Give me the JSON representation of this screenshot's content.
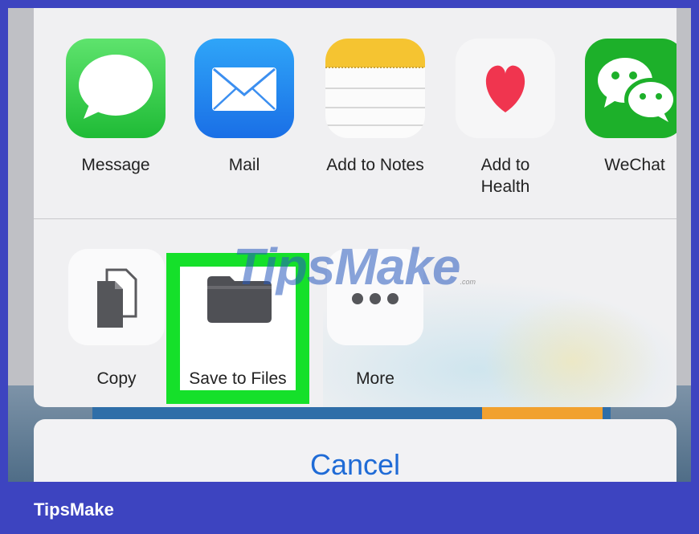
{
  "apps": [
    {
      "label": "Message",
      "icon": "messages-icon"
    },
    {
      "label": "Mail",
      "icon": "mail-icon"
    },
    {
      "label": "Add to Notes",
      "icon": "notes-icon"
    },
    {
      "label": "Add to\nHealth",
      "icon": "health-icon"
    },
    {
      "label": "WeChat",
      "icon": "wechat-icon"
    }
  ],
  "actions": [
    {
      "label": "Copy",
      "icon": "copy-icon"
    },
    {
      "label": "Save to Files",
      "icon": "folder-icon",
      "highlighted": true
    },
    {
      "label": "More",
      "icon": "more-icon"
    }
  ],
  "cancel_label": "Cancel",
  "watermark": {
    "text": "TipsMake",
    "suffix": ".com"
  },
  "brand_label": "TipsMake",
  "colors": {
    "frame": "#3d44c0",
    "highlight": "#15e02a",
    "cancel_text": "#1f6bd6"
  }
}
